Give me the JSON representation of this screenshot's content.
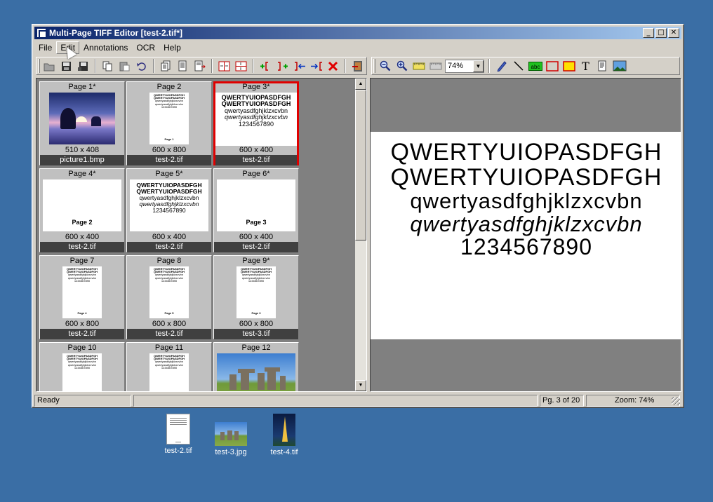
{
  "window": {
    "title": "Multi-Page TIFF Editor [test-2.tif*]",
    "caption_buttons": [
      "_",
      "□",
      "✕"
    ]
  },
  "menu": [
    "File",
    "Edit",
    "Annotations",
    "OCR",
    "Help"
  ],
  "toolbar": {
    "zoom_value": "74%"
  },
  "thumbnails": [
    {
      "page": "Page 1*",
      "dims": "510 x 408",
      "file": "picture1.bmp"
    },
    {
      "page": "Page 2",
      "dims": "600 x 800",
      "file": "test-2.tif",
      "inner_label": "Page 1"
    },
    {
      "page": "Page 3*",
      "dims": "600 x 400",
      "file": "test-2.tif"
    },
    {
      "page": "Page 4*",
      "dims": "600 x 400",
      "file": "test-2.tif",
      "inner_label": "Page 2"
    },
    {
      "page": "Page 5*",
      "dims": "600 x 400",
      "file": "test-2.tif"
    },
    {
      "page": "Page 6*",
      "dims": "600 x 400",
      "file": "test-2.tif",
      "inner_label": "Page 3"
    },
    {
      "page": "Page 7",
      "dims": "600 x 800",
      "file": "test-2.tif",
      "inner_label": "Page 4"
    },
    {
      "page": "Page 8",
      "dims": "600 x 800",
      "file": "test-2.tif",
      "inner_label": "Page 5"
    },
    {
      "page": "Page 9*",
      "dims": "600 x 800",
      "file": "test-3.tif",
      "inner_label": "Page 3"
    },
    {
      "page": "Page 10"
    },
    {
      "page": "Page 11"
    },
    {
      "page": "Page 12"
    }
  ],
  "sample_text": {
    "line1": "QWERTYUIOPASDFGH",
    "line2": "QWERTYUIOPASDFGH",
    "line3": "qwertyasdfghjklzxcvbn",
    "line4": "qwertyasdfghjklzxcvbn",
    "line5": "1234567890"
  },
  "status": {
    "state": "Ready",
    "page": "Pg. 3 of 20",
    "zoom": "Zoom: 74%"
  },
  "desktop_icons": [
    "test-2.tif",
    "test-3.jpg",
    "test-4.tif"
  ]
}
